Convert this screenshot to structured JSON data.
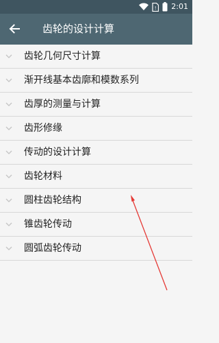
{
  "status_bar": {
    "time": "2:01",
    "icons": [
      "wifi-icon",
      "sim-card-icon",
      "battery-icon"
    ]
  },
  "app_bar": {
    "back_icon": "arrow-left-icon",
    "title": "齿轮的设计计算"
  },
  "list": {
    "items": [
      {
        "label": "齿轮几何尺寸计算"
      },
      {
        "label": "渐开线基本齿廓和模数系列"
      },
      {
        "label": "齿厚的测量与计算"
      },
      {
        "label": "齿形修缘"
      },
      {
        "label": "传动的设计计算"
      },
      {
        "label": "齿轮材料"
      },
      {
        "label": "圆柱齿轮结构"
      },
      {
        "label": "锥齿轮传动"
      },
      {
        "label": "圆弧齿轮传动"
      }
    ],
    "chevron_icon": "chevron-down-icon"
  },
  "colors": {
    "status_bar": "#3f5560",
    "app_bar": "#4e6772",
    "background": "#f5f5f5",
    "divider": "#d7d7d7",
    "annotation_arrow": "#e53935"
  }
}
